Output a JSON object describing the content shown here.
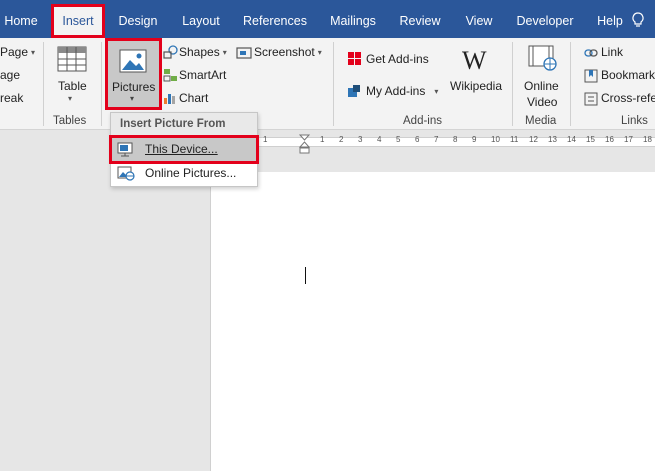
{
  "tabs": [
    {
      "label": "Home",
      "active": false
    },
    {
      "label": "Insert",
      "active": true
    },
    {
      "label": "Design",
      "active": false
    },
    {
      "label": "Layout",
      "active": false
    },
    {
      "label": "References",
      "active": false
    },
    {
      "label": "Mailings",
      "active": false
    },
    {
      "label": "Review",
      "active": false
    },
    {
      "label": "View",
      "active": false
    },
    {
      "label": "Developer",
      "active": false
    },
    {
      "label": "Help",
      "active": false
    }
  ],
  "ribbon": {
    "pages": {
      "page_label": "Page",
      "page_break_label": "age",
      "break_label": "reak"
    },
    "tables": {
      "table_label": "Table",
      "group_label": "Tables"
    },
    "illustrations": {
      "pictures_label": "Pictures",
      "shapes_label": "Shapes",
      "smartart_label": "SmartArt",
      "chart_label": "Chart",
      "screenshot_label": "Screenshot"
    },
    "addins": {
      "get_addins_label": "Get Add-ins",
      "my_addins_label": "My Add-ins",
      "wikipedia_label": "Wikipedia",
      "group_label": "Add-ins"
    },
    "media": {
      "online_label": "Online",
      "video_label": "Video",
      "group_label": "Media"
    },
    "links": {
      "link_label": "Link",
      "bookmark_label": "Bookmark",
      "crossref_label": "Cross-refe",
      "group_label": "Links"
    }
  },
  "dropdown": {
    "header": "Insert Picture From",
    "items": [
      {
        "label": "This Device...",
        "selected": true
      },
      {
        "label": "Online Pictures...",
        "selected": false
      }
    ]
  },
  "ruler": {
    "marks": [
      "1",
      "1",
      "2",
      "3",
      "4",
      "5",
      "6",
      "7",
      "8",
      "9",
      "10",
      "11",
      "12",
      "13",
      "14",
      "15",
      "16",
      "17",
      "18"
    ]
  },
  "colors": {
    "tab_bar": "#2b579a",
    "highlight": "#e3001b",
    "ribbon_bg": "#f3f3f3"
  }
}
